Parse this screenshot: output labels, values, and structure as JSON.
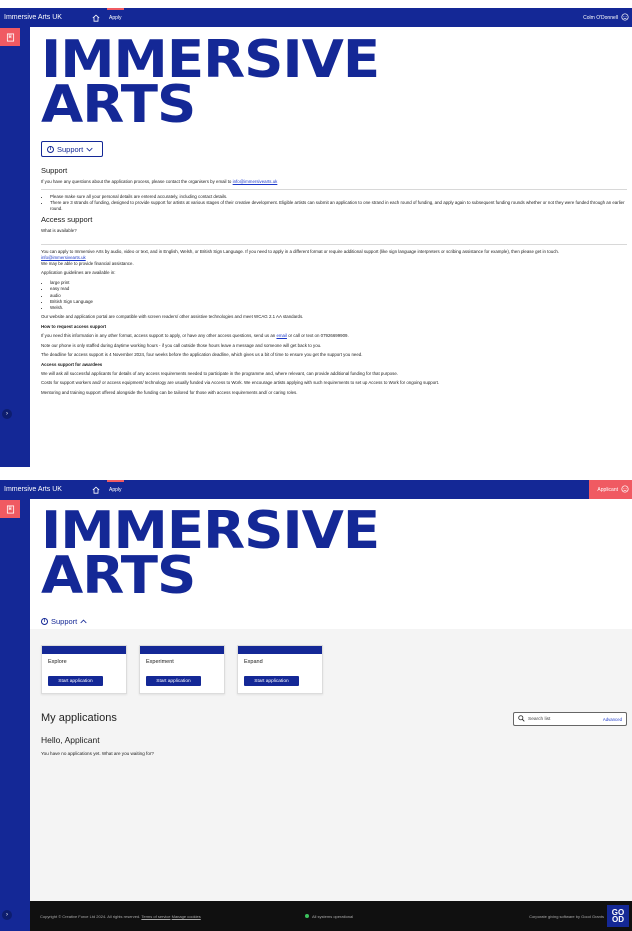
{
  "topbar": {
    "brand": "Immersive Arts UK",
    "apply": "Apply",
    "user_name": "Colm O'Donnell",
    "applicant": "Applicant"
  },
  "logo": {
    "line1": "IMMERSIVE",
    "line2": "ARTS"
  },
  "support_toggle": "Support",
  "support": {
    "title": "Support",
    "intro_pre": "If you have any questions about the application process, please contact the organisers by email to",
    "intro_email": "info@immersivearts.uk",
    "bullets": [
      "Please make sure all your personal details are entered accurately, including contact details.",
      "There are 3 strands of funding, designed to provide support for artists at various stages of their creative development. Eligible artists can submit an application to one strand in each round of funding, and apply again to subsequent funding rounds whether or not they were funded through an earlier round."
    ],
    "access_title": "Access support",
    "what_available": "What is available?",
    "apply_ways": "You can apply to Immersive Arts by audio, video or text, and in English, Welsh, or British Sign Language. If you need to apply in a different format or require additional support (like sign language interpreters or scribing assistance for example), then please get in touch.",
    "access_email": "info@immersivearts.uk",
    "financial": "We may be able to provide financial assistance.",
    "guidelines_intro": "Application guidelines are available in:",
    "formats": [
      "large print",
      "easy read",
      "audio",
      "British Sign Language",
      "Welsh."
    ],
    "wcag": "Our website and application portal are compatible with screen readers/ other assistive technologies and meet WCAG 2.1 AA standards.",
    "how_title": "How to request access support",
    "how_pre": "If you need this information in any other format, access support to apply, or have any other access questions, send us an",
    "how_link": "email",
    "how_post": "or call or text on 07926699909.",
    "phone_note": "Note our phone is only staffed during daytime working hours - if you call outside those hours leave a message and someone will get back to you.",
    "deadline": "The deadline for access support is 4 November 2024, four weeks before the application deadline, which gives us a bit of time to ensure you get the support you need.",
    "awardees_title": "Access support for awardees",
    "awardees_1": "We will ask all successful applicants for details of any access requirements needed to participate in the programme and, where relevant, can provide additional funding for that purpose.",
    "awardees_2": "Costs for support workers and/ or access equipment/ technology are usually funded via Access to Work. We encourage artists applying with such requirements to set up Access to Work for ongoing support.",
    "awardees_3": "Mentoring and training support offered alongside the funding can be tailored for those with access requirements and/ or caring roles."
  },
  "programs": [
    {
      "name": "Explore",
      "button": "Start application"
    },
    {
      "name": "Experiment",
      "button": "Start application"
    },
    {
      "name": "Expand",
      "button": "Start application"
    }
  ],
  "my_applications": {
    "title": "My applications",
    "search_placeholder": "Search list",
    "advanced": "Advanced",
    "greeting": "Hello, Applicant",
    "empty": "You have no applications yet. What are you waiting for?"
  },
  "footer": {
    "copyright": "Copyright © Creative Force Ltd 2024. All rights reserved.",
    "terms": "Terms of service",
    "cookies": "Manage cookies",
    "status": "All systems operational",
    "corporate": "Corporate giving software by Good Grants",
    "gg1": "GO",
    "gg2": "OD"
  },
  "colors": {
    "brand": "#142896",
    "accent": "#f05a62",
    "status_ok": "#3cc25d"
  }
}
